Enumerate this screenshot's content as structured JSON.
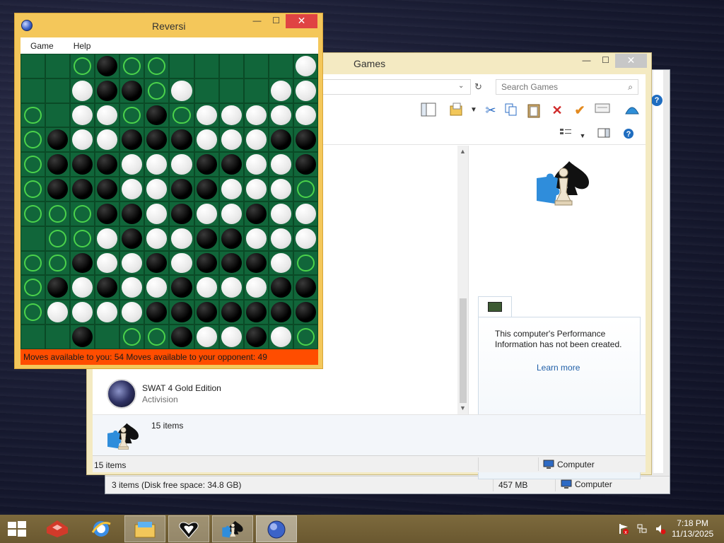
{
  "reversi": {
    "title": "Reversi",
    "menu": [
      "Game",
      "Help"
    ],
    "status": "Moves available to you:  54  Moves available to your opponent:  49",
    "board": [
      "..mbmm.....w",
      "..wbbmw...ww",
      "m.wwmbmwwwww",
      "mbwwbbbwwwbb",
      "mbbbwwwbbwwb",
      "mbbbwwbbwwwm",
      "mmmbbwbwwbww",
      ".mmwbwwbbwww",
      "mmbwwbwbbbwm",
      "mbwbwwbwwwbb",
      "mwwwwbbbbbbb",
      "..b.mmbwwbwm"
    ]
  },
  "games_window": {
    "title": "Games",
    "search_placeholder": "Search Games",
    "game_entry": {
      "name": "SWAT 4 Gold Edition",
      "publisher": "Activision"
    },
    "perf_text": "This computer's Performance Information has not been created.",
    "perf_link": "Learn more",
    "details_count": "15 items",
    "status_items": "15 items",
    "status_location": "Computer"
  },
  "back_window": {
    "status_items": "3 items (Disk free space: 34.8 GB)",
    "status_size": "457 MB",
    "status_location": "Computer"
  },
  "taskbar": {
    "time": "7:18 PM",
    "date": "11/13/2025"
  },
  "colors": {
    "board_green": "#11663a",
    "window_frame": "#f4c75a",
    "status_orange": "#ff4d00",
    "taskbar": "#7d6a3d"
  }
}
